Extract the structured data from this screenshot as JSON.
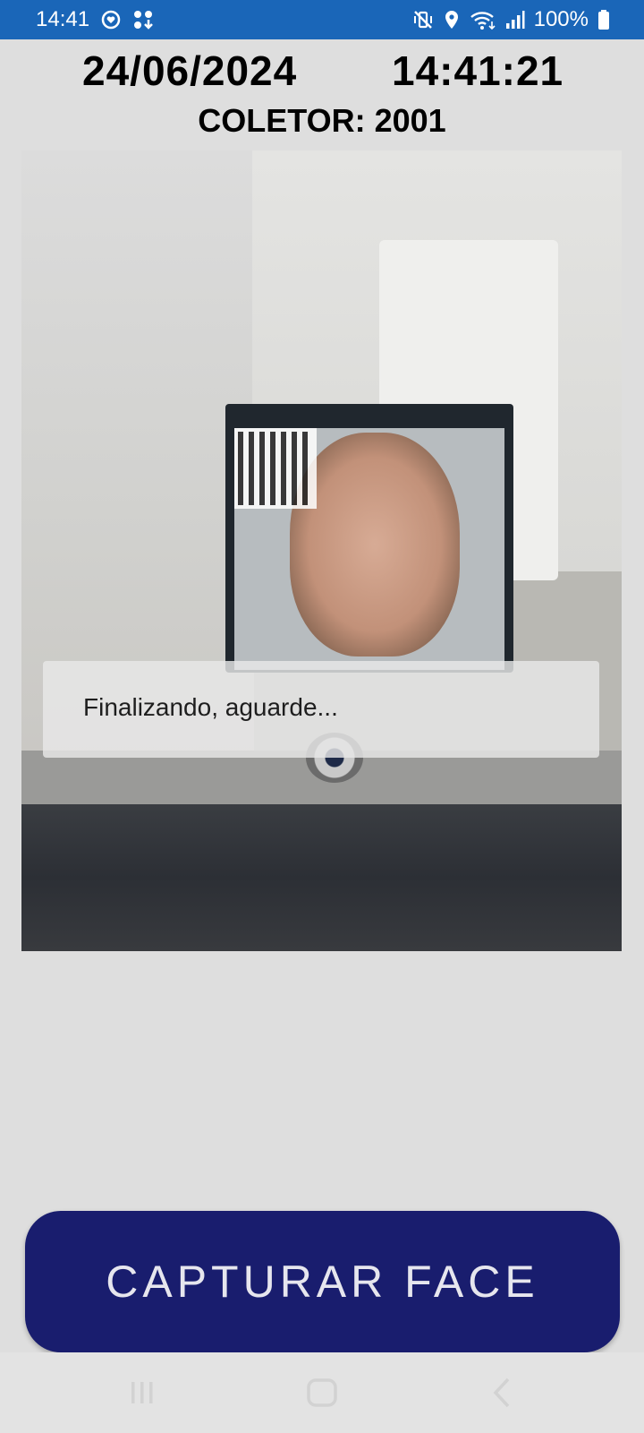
{
  "status_bar": {
    "time": "14:41",
    "battery_percent": "100%",
    "icons_left": [
      "sync-heart-icon",
      "apps-download-icon"
    ],
    "icons_right": [
      "mute-vibrate-icon",
      "location-icon",
      "wifi-icon",
      "signal-icon",
      "battery-icon"
    ],
    "background_color": "#1a66b8"
  },
  "header": {
    "date": "24/06/2024",
    "clock": "14:41:21",
    "collector_label": "COLETOR: 2001"
  },
  "camera_overlay": {
    "message": "Finalizando, aguarde..."
  },
  "actions": {
    "capture_label": "CAPTURAR FACE",
    "capture_color": "#191d6e"
  },
  "nav_bar": {
    "buttons": [
      "recents-icon",
      "home-icon",
      "back-icon"
    ]
  }
}
